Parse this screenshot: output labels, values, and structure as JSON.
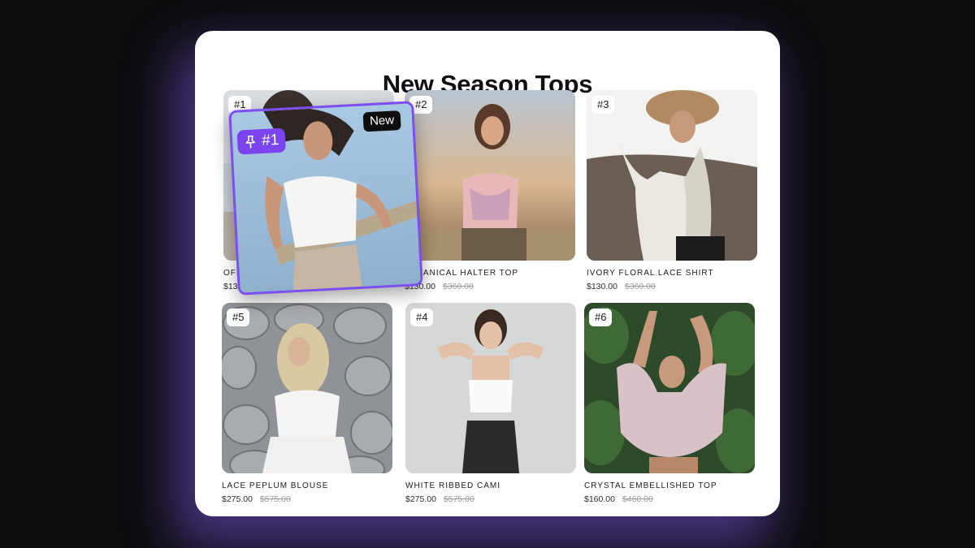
{
  "page": {
    "title": "New Season Tops"
  },
  "products": [
    {
      "rank": "#1",
      "name": "OFF S",
      "price": "$130.0",
      "old_price": ""
    },
    {
      "rank": "#2",
      "name": "BOTANICAL HALTER TOP",
      "price": "$130.00",
      "old_price": "$360.00"
    },
    {
      "rank": "#3",
      "name": "IVORY FLORAL LACE SHIRT",
      "price": "$130.00",
      "old_price": "$360.00"
    },
    {
      "rank": "#5",
      "name": "LACE PEPLUM BLOUSE",
      "price": "$275.00",
      "old_price": "$575.00"
    },
    {
      "rank": "#4",
      "name": "WHITE RIBBED CAMI",
      "price": "$275.00",
      "old_price": "$575.00"
    },
    {
      "rank": "#6",
      "name": "CRYSTAL EMBELLISHED TOP",
      "price": "$160.00",
      "old_price": "$460.00"
    }
  ],
  "dragging": {
    "pin_label": "#1",
    "new_label": "New",
    "pin_icon": "pin-icon"
  },
  "colors": {
    "accent": "#7a45ee",
    "background": "#0d0c0e",
    "panel": "#ffffff"
  }
}
